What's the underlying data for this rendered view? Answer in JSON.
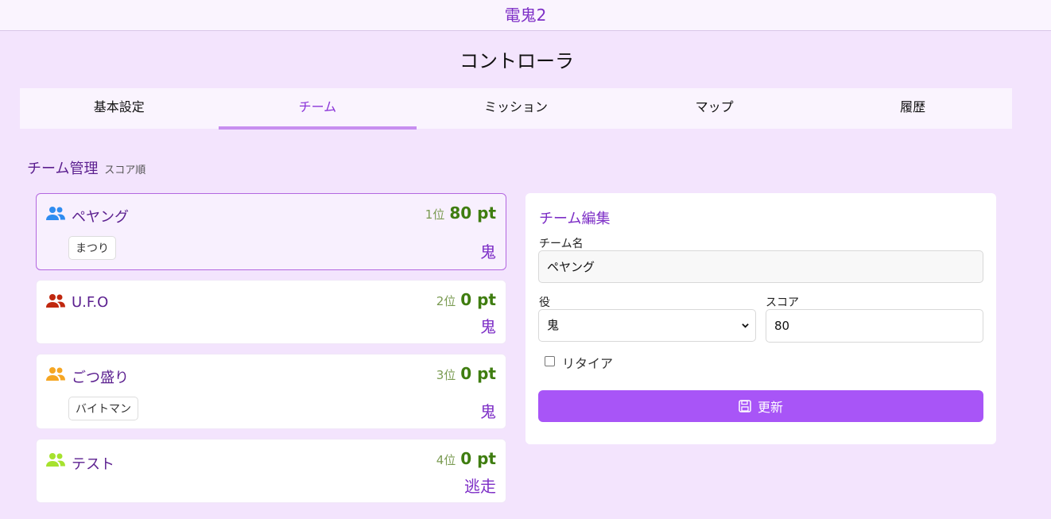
{
  "app": {
    "title": "電鬼2"
  },
  "page": {
    "title": "コントローラ"
  },
  "tabs": [
    {
      "label": "基本設定",
      "active": false
    },
    {
      "label": "チーム",
      "active": true
    },
    {
      "label": "ミッション",
      "active": false
    },
    {
      "label": "マップ",
      "active": false
    },
    {
      "label": "履歴",
      "active": false
    }
  ],
  "section": {
    "title": "チーム管理",
    "subtitle": "スコア順"
  },
  "teams": [
    {
      "name": "ペヤング",
      "rank": "1位",
      "score": "80 pt",
      "role": "鬼",
      "member": "まつり",
      "icon_color": "#2f8cf0",
      "selected": true
    },
    {
      "name": "U.F.O",
      "rank": "2位",
      "score": "0 pt",
      "role": "鬼",
      "member": "",
      "icon_color": "#c0280f",
      "selected": false
    },
    {
      "name": "ごつ盛り",
      "rank": "3位",
      "score": "0 pt",
      "role": "鬼",
      "member": "バイトマン",
      "icon_color": "#f5a623",
      "selected": false
    },
    {
      "name": "テスト",
      "rank": "4位",
      "score": "0 pt",
      "role": "逃走",
      "member": "",
      "icon_color": "#a6e22e",
      "selected": false
    }
  ],
  "edit": {
    "title": "チーム編集",
    "name_label": "チーム名",
    "name_value": "ペヤング",
    "role_label": "役",
    "role_value": "鬼",
    "score_label": "スコア",
    "score_value": "80",
    "retire_label": "リタイア",
    "retire_checked": false,
    "update_label": "更新"
  },
  "icons": {
    "team": "users-icon",
    "save": "save-icon",
    "select": "chevron-down-icon"
  }
}
